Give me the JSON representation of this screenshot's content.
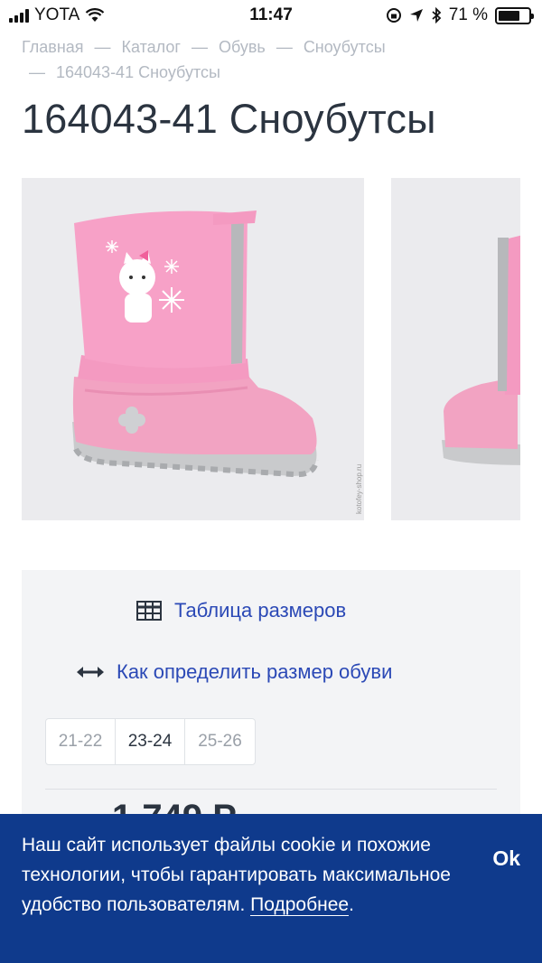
{
  "status_bar": {
    "carrier": "YOTA",
    "time": "11:47",
    "battery_percent": "71 %",
    "battery_level": 0.71
  },
  "breadcrumb": {
    "items": [
      "Главная",
      "Каталог",
      "Обувь",
      "Сноубутсы",
      "164043-41 Сноубутсы"
    ],
    "separator": "—"
  },
  "page_title": "164043-41 Сноубутсы",
  "gallery": {
    "watermark": "kotofey-shop.ru"
  },
  "links": {
    "size_table": "Таблица размеров",
    "how_to_size": "Как определить размер обуви"
  },
  "sizes": {
    "options": [
      "21-22",
      "23-24",
      "25-26"
    ],
    "selected": "23-24"
  },
  "price_peek": "1 749 Р",
  "cookie": {
    "text": "Наш сайт использует файлы cookie и похожие технологии, чтобы гарантировать максимальное удобство пользователям. ",
    "link": "Подробнее",
    "suffix": ".",
    "ok": "Ok"
  },
  "colors": {
    "accent_link": "#2b49b6",
    "banner": "#0f3a8c",
    "boot_pink": "#f49ac1"
  }
}
